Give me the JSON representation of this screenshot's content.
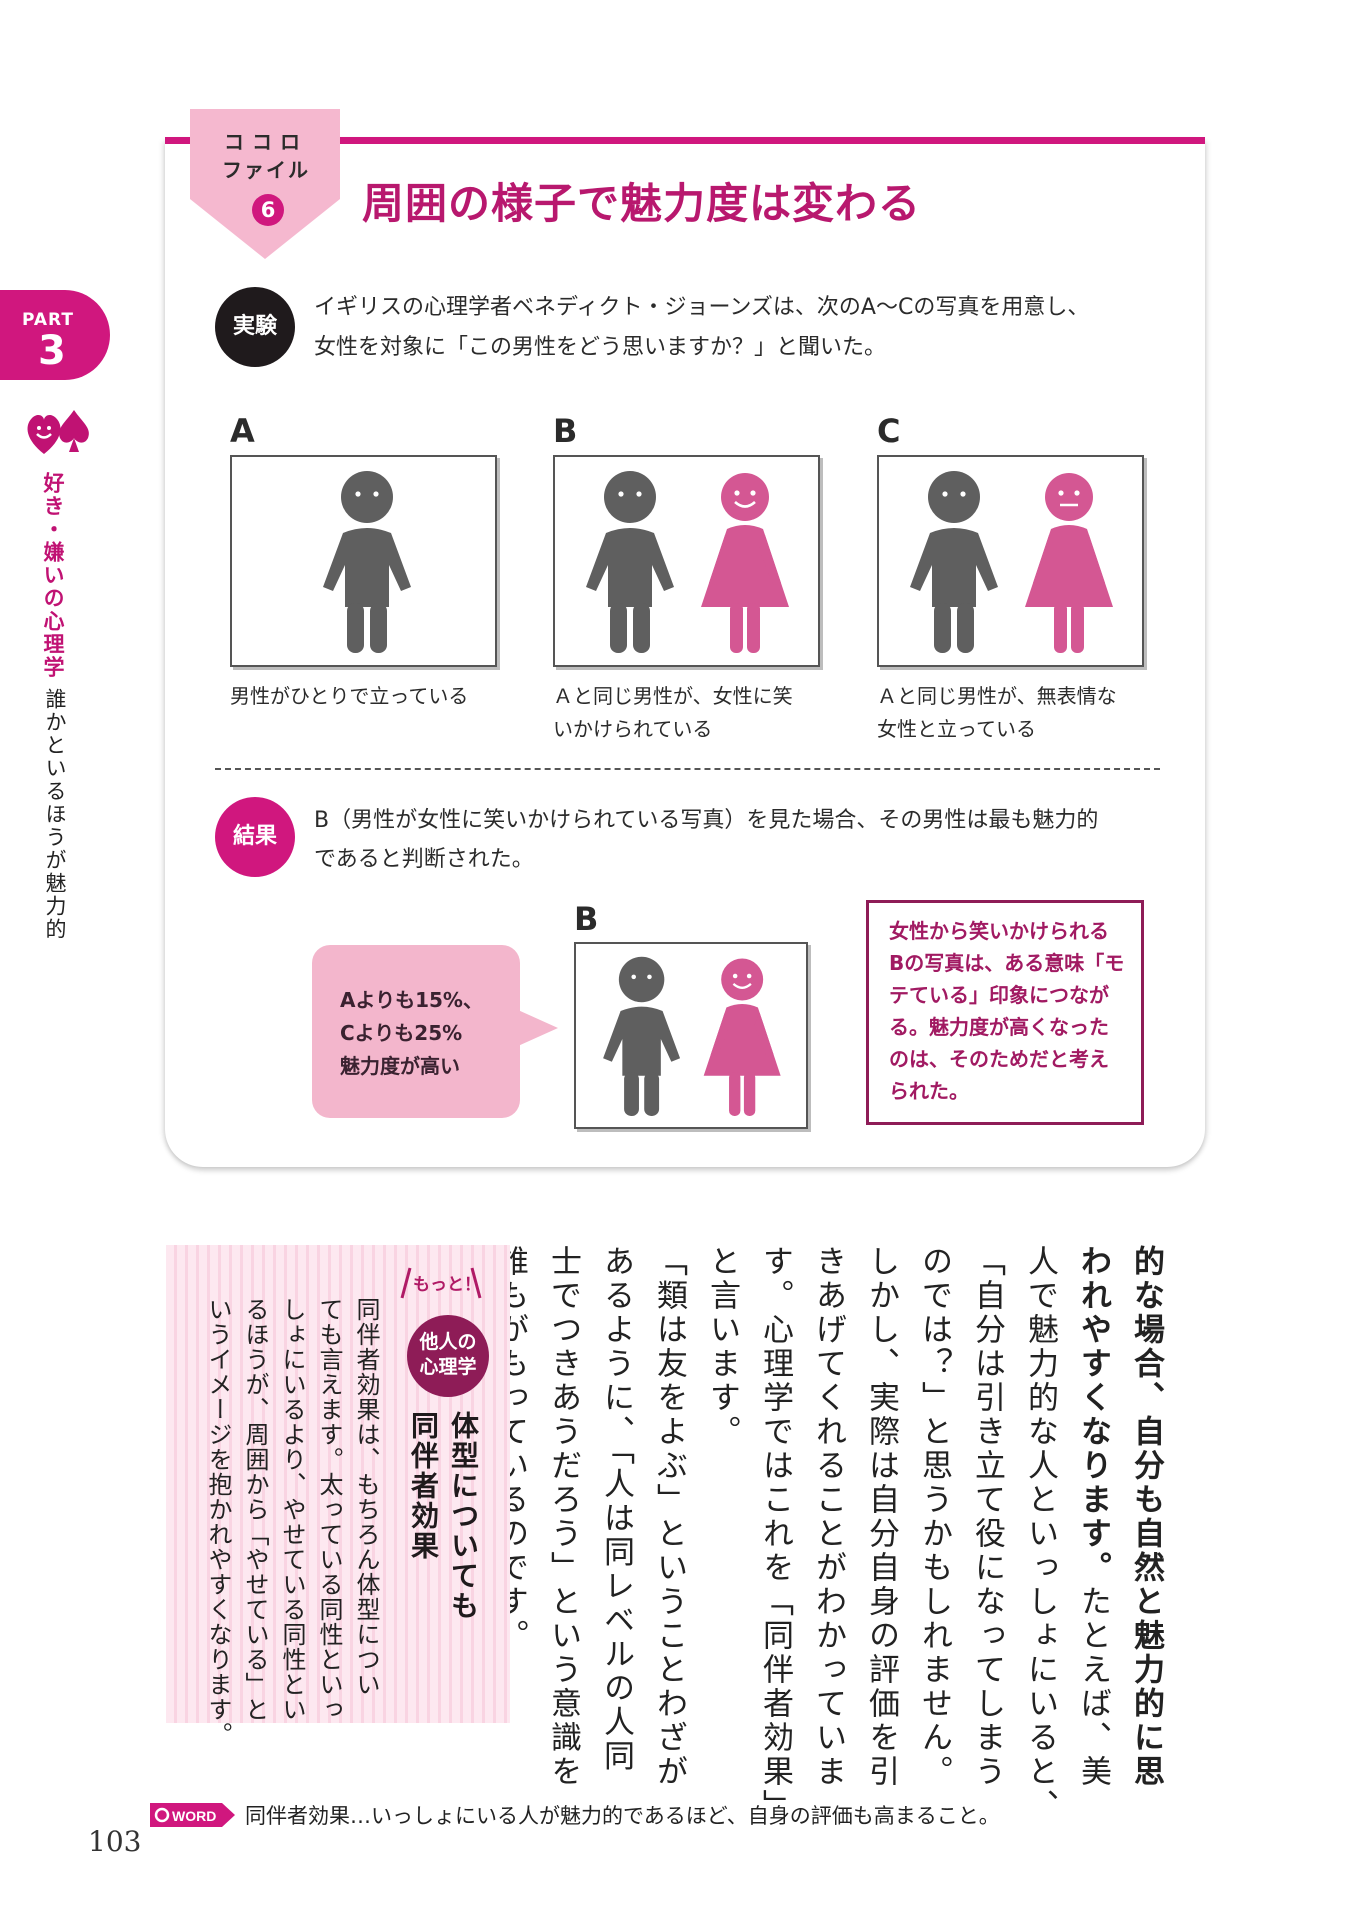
{
  "sidebar": {
    "part_label": "PART",
    "part_number": "3",
    "category": "好き・嫌いの心理学",
    "topic": "誰かといるほうが魅力的"
  },
  "header": {
    "file_label_1": "ココロ",
    "file_label_2": "ファイル",
    "file_number": "6",
    "title": "周囲の様子で魅力度は変わる"
  },
  "experiment": {
    "badge": "実験",
    "line1": "イギリスの心理学者ベネディクト・ジョーンズは、次のA～Cの写真を用意し、",
    "line2": "女性を対象に「この男性をどう思いますか？」と聞いた。"
  },
  "panels": [
    {
      "letter": "A",
      "caption_line1": "男性がひとりで立っている",
      "caption_line2": ""
    },
    {
      "letter": "B",
      "caption_line1": "Ａと同じ男性が、女性に笑",
      "caption_line2": "いかけられている"
    },
    {
      "letter": "C",
      "caption_line1": "Ａと同じ男性が、無表情な",
      "caption_line2": "女性と立っている"
    }
  ],
  "result": {
    "badge": "結果",
    "line1": "B（男性が女性に笑いかけられている写真）を見た場合、その男性は最も魅力的",
    "line2": "であると判断された。",
    "panel_letter": "B",
    "bubble": [
      "Aよりも15%、",
      "Cよりも25%",
      "魅力度が高い"
    ],
    "note": [
      "女性から笑いかけられる",
      "Bの写真は、ある意味「モ",
      "テている」印象につなが",
      "る。魅力度が高くなった",
      "のは、そのためだと考え",
      "られた。"
    ]
  },
  "body_columns": [
    {
      "text": "的な場合、自分も自然と魅力的に思",
      "bold": true
    },
    {
      "text": "われやすくなります。たとえば、美",
      "bold": "partial"
    },
    {
      "text": "人で魅力的な人といっしょにいると、",
      "bold": false
    },
    {
      "text": "「自分は引き立て役になってしまう",
      "bold": false
    },
    {
      "text": "のでは？」と思うかもしれません。",
      "bold": false
    },
    {
      "text": "しかし、実際は自分自身の評価を引",
      "bold": false
    },
    {
      "text": "きあげてくれることがわかっていま",
      "bold": false
    },
    {
      "text": "す。心理学ではこれを「同伴者効果」",
      "bold": false
    },
    {
      "text": "と言います。",
      "bold": false
    },
    {
      "text": "「類は友をよぶ」ということわざが",
      "bold": false
    },
    {
      "text": "あるように、「人は同レベルの人同",
      "bold": false
    },
    {
      "text": "士でつきあうだろう」という意識を",
      "bold": false
    },
    {
      "text": "誰もがもっているのです。",
      "bold": false
    }
  ],
  "column": {
    "motto": "もっと！",
    "badge_line1": "他人の",
    "badge_line2": "心理学",
    "heading_line1": "体型についても",
    "heading_line2": "同伴者効果",
    "body": [
      "同伴者効果は、もちろん体型につい",
      "ても言えます。太っている同性といっ",
      "しょにいるより、やせている同性とい",
      "るほうが、周囲から「やせている」と",
      "いうイメージを抱かれやすくなります。"
    ]
  },
  "footer": {
    "word_label": "WORD",
    "word_text": "同伴者効果…いっしょにいる人が魅力的であるほど、自身の評価も高まること。",
    "page_number": "103"
  },
  "colors": {
    "accent": "#d0177e",
    "dark_accent": "#8e1c57",
    "man": "#5f5f5f",
    "woman": "#d45793"
  }
}
